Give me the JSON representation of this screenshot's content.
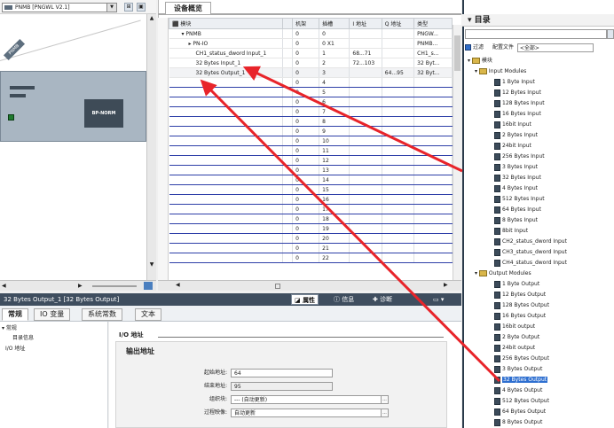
{
  "left": {
    "device_select": "PNMB [PNGWL V2.1]",
    "tag": "PNMB",
    "module_label": "BP-NORM"
  },
  "overview": {
    "tab": "设备概览",
    "columns": [
      "模块",
      "",
      "机架",
      "插槽",
      "I 地址",
      "Q 地址",
      "类型"
    ],
    "rows": [
      {
        "module": "PNMB",
        "rack": "0",
        "slot": "0",
        "i": "",
        "q": "",
        "type": "PNGW..."
      },
      {
        "module": "PN-IO",
        "rack": "0",
        "slot": "0 X1",
        "i": "",
        "q": "",
        "type": "PNMB..."
      },
      {
        "module": "CH1_status_dword Input_1",
        "rack": "0",
        "slot": "1",
        "i": "68...71",
        "q": "",
        "type": "CH1_s..."
      },
      {
        "module": "32 Bytes Input_1",
        "rack": "0",
        "slot": "2",
        "i": "72...103",
        "q": "",
        "type": "32 Byt..."
      },
      {
        "module": "32 Bytes Output_1",
        "rack": "0",
        "slot": "3",
        "i": "",
        "q": "64...95",
        "type": "32 Byt..."
      },
      {
        "module": "",
        "rack": "0",
        "slot": "4",
        "i": "",
        "q": "",
        "type": ""
      },
      {
        "module": "",
        "rack": "0",
        "slot": "5",
        "i": "",
        "q": "",
        "type": ""
      },
      {
        "module": "",
        "rack": "0",
        "slot": "6",
        "i": "",
        "q": "",
        "type": ""
      },
      {
        "module": "",
        "rack": "0",
        "slot": "7",
        "i": "",
        "q": "",
        "type": ""
      },
      {
        "module": "",
        "rack": "0",
        "slot": "8",
        "i": "",
        "q": "",
        "type": ""
      },
      {
        "module": "",
        "rack": "0",
        "slot": "9",
        "i": "",
        "q": "",
        "type": ""
      },
      {
        "module": "",
        "rack": "0",
        "slot": "10",
        "i": "",
        "q": "",
        "type": ""
      },
      {
        "module": "",
        "rack": "0",
        "slot": "11",
        "i": "",
        "q": "",
        "type": ""
      },
      {
        "module": "",
        "rack": "0",
        "slot": "12",
        "i": "",
        "q": "",
        "type": ""
      },
      {
        "module": "",
        "rack": "0",
        "slot": "13",
        "i": "",
        "q": "",
        "type": ""
      },
      {
        "module": "",
        "rack": "0",
        "slot": "14",
        "i": "",
        "q": "",
        "type": ""
      },
      {
        "module": "",
        "rack": "0",
        "slot": "15",
        "i": "",
        "q": "",
        "type": ""
      },
      {
        "module": "",
        "rack": "0",
        "slot": "16",
        "i": "",
        "q": "",
        "type": ""
      },
      {
        "module": "",
        "rack": "0",
        "slot": "17",
        "i": "",
        "q": "",
        "type": ""
      },
      {
        "module": "",
        "rack": "0",
        "slot": "18",
        "i": "",
        "q": "",
        "type": ""
      },
      {
        "module": "",
        "rack": "0",
        "slot": "19",
        "i": "",
        "q": "",
        "type": ""
      },
      {
        "module": "",
        "rack": "0",
        "slot": "20",
        "i": "",
        "q": "",
        "type": ""
      },
      {
        "module": "",
        "rack": "0",
        "slot": "21",
        "i": "",
        "q": "",
        "type": ""
      },
      {
        "module": "",
        "rack": "0",
        "slot": "22",
        "i": "",
        "q": "",
        "type": ""
      }
    ]
  },
  "catalog": {
    "title": "目录",
    "filter_label": "过滤",
    "profile_label": "配置文件",
    "profile_value": "<全部>",
    "root": "模块",
    "input_folder": "Input Modules",
    "inputs": [
      "1 Byte Input",
      "12 Bytes Input",
      "128 Bytes Input",
      "16 Bytes Input",
      "16bit Input",
      "2 Bytes Input",
      "24bit Input",
      "256 Bytes Input",
      "3 Bytes Input",
      "32 Bytes Input",
      "4 Bytes Input",
      "512 Bytes Input",
      "64 Bytes Input",
      "8 Bytes Input",
      "8bit Input",
      "CH2_status_dword Input",
      "CH3_status_dword Input",
      "CH4_status_dword Input"
    ],
    "output_folder": "Output Modules",
    "outputs": [
      "1 Byte Output",
      "12 Bytes Output",
      "128 Bytes Output",
      "16 Bytes Output",
      "16bit output",
      "2 Byte Output",
      "24bit output",
      "256 Bytes Output",
      "3 Bytes Output",
      "32 Bytes Output",
      "4 Bytes Output",
      "512 Bytes Output",
      "64 Bytes Output",
      "8 Bytes Output"
    ],
    "selected_output": "32 Bytes Output"
  },
  "props": {
    "title": "32 Bytes Output_1 [32 Bytes Output]",
    "tab_properties": "属性",
    "tab_info": "信息",
    "tab_diag": "诊断",
    "subtabs": [
      "常规",
      "IO 变量",
      "系统常数",
      "文本"
    ],
    "nav": {
      "general": "常规",
      "catalog_info": "目录信息",
      "io_address": "I/O 地址"
    },
    "io_heading": "I/O 地址",
    "output_heading": "输出地址",
    "start_label": "起始地址:",
    "start_value": "64",
    "end_label": "结束地址:",
    "end_value": "95",
    "ob_label": "组织块:",
    "ob_value": "--- (自动更新)",
    "pi_label": "过程映像:",
    "pi_value": "自动更新"
  },
  "colors": {
    "accent": "#2e6fd0",
    "arrow": "#e8242a",
    "title_bar": "#3f4e5f"
  }
}
